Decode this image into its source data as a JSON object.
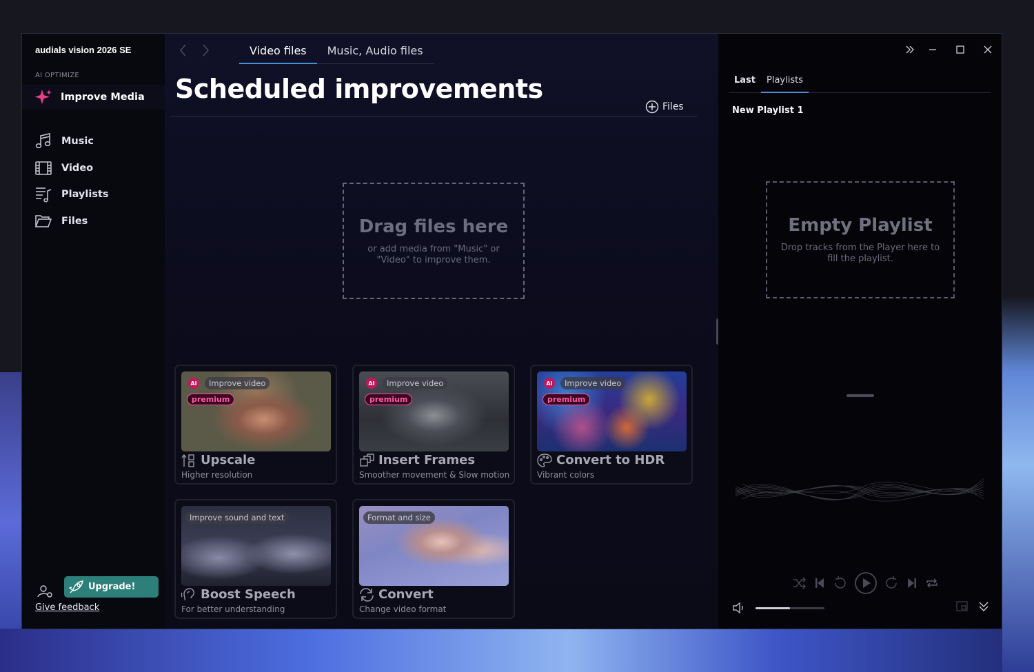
{
  "app": {
    "title": "audials vision 2026 SE"
  },
  "sidebar": {
    "section_label": "AI OPTIMIZE",
    "improve_label": "Improve Media",
    "items": [
      {
        "label": "Music",
        "icon": "music-icon"
      },
      {
        "label": "Video",
        "icon": "film-icon"
      },
      {
        "label": "Playlists",
        "icon": "playlist-icon"
      },
      {
        "label": "Files",
        "icon": "folder-icon"
      }
    ],
    "upgrade_label": "Upgrade!",
    "feedback_label": "Give feedback"
  },
  "main": {
    "tabs": [
      {
        "label": "Video files",
        "active": true
      },
      {
        "label": "Music, Audio files",
        "active": false
      }
    ],
    "title": "Scheduled improvements",
    "files_button": "Files",
    "dropzone": {
      "title": "Drag files here",
      "subtitle": "or add media from \"Music\" or \"Video\" to improve them."
    },
    "cards": [
      {
        "tag": "Improve video",
        "ai": "AI",
        "premium": "premium",
        "title": "Upscale",
        "desc": "Higher resolution",
        "icon": "upscale-icon"
      },
      {
        "tag": "Improve video",
        "ai": "AI",
        "premium": "premium",
        "title": "Insert Frames",
        "desc": "Smoother movement & Slow motion",
        "icon": "frames-icon"
      },
      {
        "tag": "Improve video",
        "ai": "AI",
        "premium": "premium",
        "title": "Convert to HDR",
        "desc": "Vibrant colors",
        "icon": "palette-icon"
      },
      {
        "tag": "Improve sound and text",
        "title": "Boost Speech",
        "desc": "For better understanding",
        "icon": "speech-icon"
      },
      {
        "tag": "Format and size",
        "title": "Convert",
        "desc": "Change video format",
        "icon": "convert-icon"
      }
    ]
  },
  "right": {
    "tabs": [
      {
        "label": "Last",
        "active": false
      },
      {
        "label": "Playlists",
        "active": true
      }
    ],
    "playlist_name": "New Playlist 1",
    "empty": {
      "title": "Empty Playlist",
      "subtitle": "Drop tracks from the Player here to fill the playlist."
    },
    "volume_level": 0.5
  },
  "colors": {
    "accent_blue": "#4b8fd6",
    "upgrade_teal": "#2d7f79",
    "premium_pink": "#ff4f9a",
    "improve_star": "#e63e8c"
  }
}
